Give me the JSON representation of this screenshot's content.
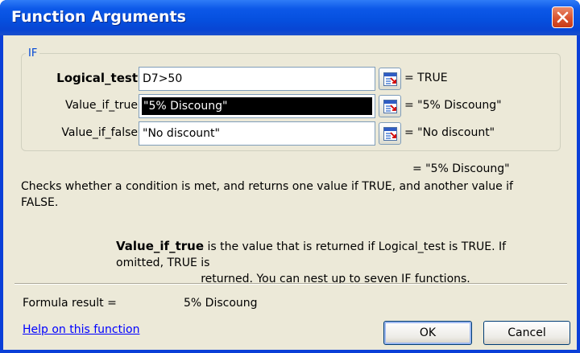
{
  "window": {
    "title": "Function Arguments"
  },
  "function_group": {
    "name": "IF"
  },
  "arguments": [
    {
      "label": "Logical_test",
      "value": "D7>50",
      "result": "= TRUE",
      "bold": true,
      "selected": false
    },
    {
      "label": "Value_if_true",
      "value": "\"5% Discoung\"",
      "result": "= \"5% Discoung\"",
      "bold": false,
      "selected": true
    },
    {
      "label": "Value_if_false",
      "value": "\"No discount\"",
      "result": "= \"No discount\"",
      "bold": false,
      "selected": false
    }
  ],
  "function_result": "= \"5% Discoung\"",
  "description": "Checks whether a condition is met, and returns one value if TRUE, and another value if FALSE.",
  "argument_help": {
    "name": "Value_if_true",
    "text_line1": " is the value that is returned if Logical_test is TRUE. If omitted, TRUE is",
    "text_line2": "returned. You can nest up to seven IF functions."
  },
  "formula_result": {
    "label": "Formula result =",
    "value": "5% Discoung"
  },
  "help_link": "Help on this function",
  "buttons": {
    "ok": "OK",
    "cancel": "Cancel"
  },
  "colors": {
    "title_bar": "#0650df",
    "dialog_bg": "#ece9d8",
    "link": "#0000ff",
    "group_label": "#0046d5"
  },
  "icons": {
    "close": "close-icon",
    "collapse": "collapse-dialog-icon"
  }
}
